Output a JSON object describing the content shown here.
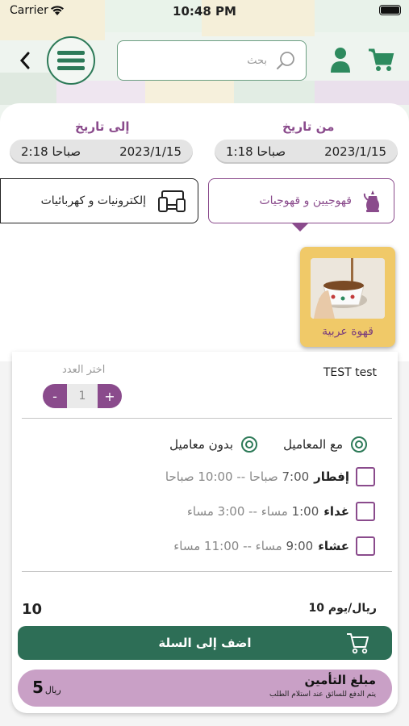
{
  "status_bar": {
    "carrier": "Carrier",
    "time": "10:48 PM"
  },
  "header": {
    "search_placeholder": "بحث"
  },
  "dates": {
    "from": {
      "label": "من تاريخ",
      "date": "2023/1/15",
      "time": "1:18 صباحا"
    },
    "to": {
      "label": "إلى تاريخ",
      "date": "2023/1/15",
      "time": "2:18 صباحا"
    }
  },
  "categories": [
    {
      "label": "قهوجيين و قهوجيات",
      "icon": "dallah-icon",
      "selected": true
    },
    {
      "label": "إلكترونيات و كهربائيات",
      "icon": "devices-icon",
      "selected": false
    }
  ],
  "subcategory": {
    "label": "قهوة عربية"
  },
  "item": {
    "name": "TEST test",
    "quantity_label": "اختر العدد",
    "quantity": "1",
    "minus": "-",
    "plus": "+"
  },
  "service_options": [
    {
      "label": "مع المعاميل",
      "selected": true
    },
    {
      "label": "بدون معاميل",
      "selected": true
    }
  ],
  "meals": [
    {
      "name": "إفطار",
      "start": "7:00",
      "start_suffix": "صباحا",
      "sep": "--",
      "end": "10:00",
      "end_suffix": "صباحا"
    },
    {
      "name": "غداء",
      "start": "1:00",
      "start_suffix": "مساء",
      "sep": "--",
      "end": "3:00",
      "end_suffix": "مساء"
    },
    {
      "name": "عشاء",
      "start": "9:00",
      "start_suffix": "مساء",
      "sep": "--",
      "end": "11:00",
      "end_suffix": "مساء"
    }
  ],
  "pricing": {
    "per_day": "10 ريال/يوم",
    "total": "10"
  },
  "add_to_cart": {
    "label": "اضف إلى السلة"
  },
  "insurance": {
    "title": "مبلغ التأمين",
    "note": "يتم الدفع للسائق عند استلام الطلب",
    "amount": "5",
    "currency": "ريال"
  },
  "colors": {
    "primary_green": "#2d6e56",
    "accent_purple": "#8a4b8c",
    "sub_bg": "#f0c968",
    "insurance_bg": "#c9a0c6"
  }
}
